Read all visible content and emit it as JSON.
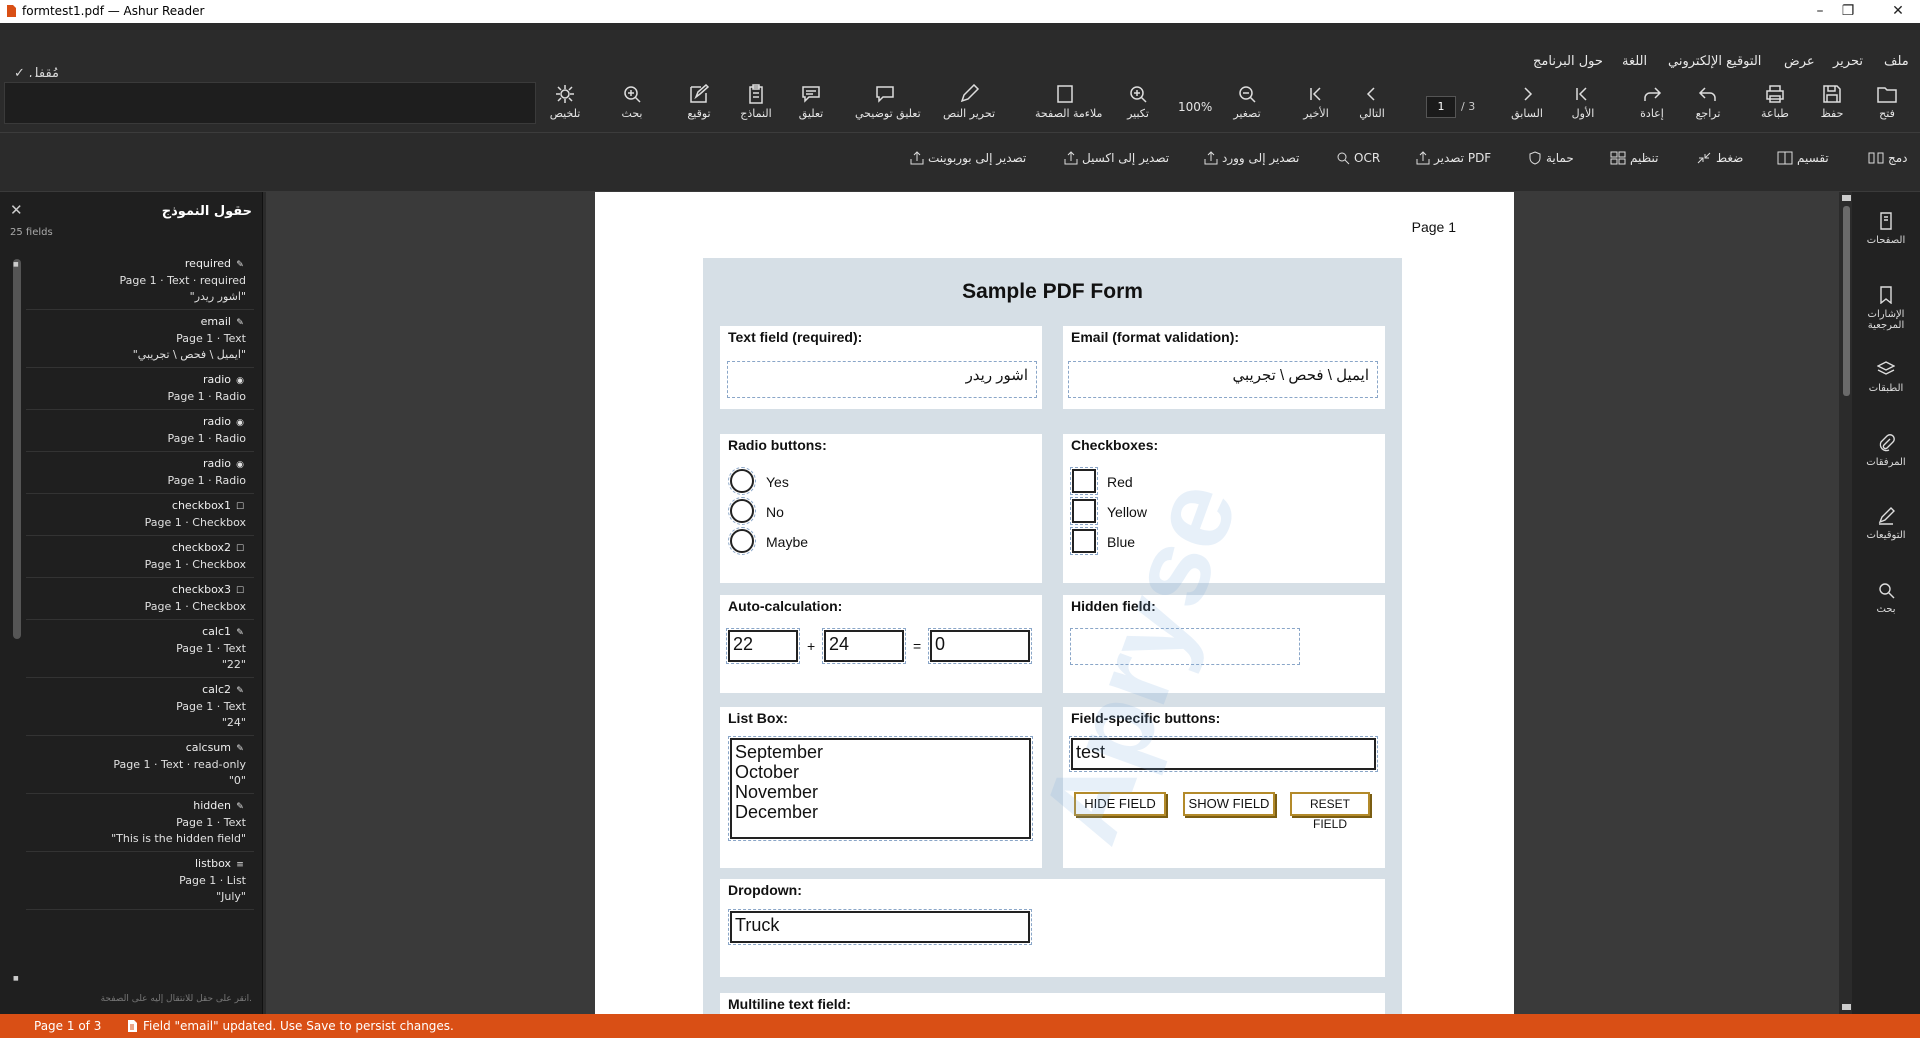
{
  "window": {
    "title": "formtest1.pdf — Ashur Reader"
  },
  "menu": {
    "items": [
      "ملف",
      "تحرير",
      "عرض",
      "التوقيع الإلكتروني",
      "اللغة",
      "حول البرنامج"
    ],
    "locked": "✓ مُقفل"
  },
  "toolbar": {
    "tools": [
      {
        "label": "فتح",
        "icon": "folder-icon"
      },
      {
        "label": "حفظ",
        "icon": "save-icon"
      },
      {
        "label": "طباعة",
        "icon": "print-icon"
      },
      {
        "label": "تراجع",
        "icon": "undo-icon"
      },
      {
        "label": "إعادة",
        "icon": "redo-icon"
      },
      {
        "label": "الأول",
        "icon": "first-page-icon"
      },
      {
        "label": "السابق",
        "icon": "prev-page-icon"
      },
      {
        "label": "التالي",
        "icon": "next-page-icon"
      },
      {
        "label": "الأخير",
        "icon": "last-page-icon"
      },
      {
        "label": "تصغير",
        "icon": "zoom-out-icon"
      },
      {
        "label": "تكبير",
        "icon": "zoom-in-icon"
      },
      {
        "label": "ملاءمة الصفحة",
        "icon": "fit-page-icon"
      },
      {
        "label": "تحرير النص",
        "icon": "edit-text-icon"
      },
      {
        "label": "تعليق توضيحي",
        "icon": "callout-icon"
      },
      {
        "label": "تعليق",
        "icon": "comment-icon"
      },
      {
        "label": "النماذج",
        "icon": "forms-icon"
      },
      {
        "label": "توقيع",
        "icon": "sign-icon"
      },
      {
        "label": "بحث",
        "icon": "search-icon"
      },
      {
        "label": "تلخيص",
        "icon": "summarize-icon"
      }
    ],
    "zoom": "100%",
    "page_current": "1",
    "page_total": "/ 3"
  },
  "toolbar2": {
    "tools": [
      {
        "label": "دمج",
        "icon": "merge-icon"
      },
      {
        "label": "تقسيم",
        "icon": "split-icon"
      },
      {
        "label": "ضغط",
        "icon": "compress-icon"
      },
      {
        "label": "تنظيم",
        "icon": "organize-icon"
      },
      {
        "label": "حماية",
        "icon": "shield-icon"
      },
      {
        "label": "تصدير PDF",
        "icon": "export-icon"
      },
      {
        "label": "OCR",
        "icon": "ocr-icon"
      },
      {
        "label": "تصدير إلى وورد",
        "icon": "export-icon"
      },
      {
        "label": "تصدير إلى اكسيل",
        "icon": "export-icon"
      },
      {
        "label": "تصدير إلى بوربوينت",
        "icon": "export-icon"
      }
    ]
  },
  "panel": {
    "title": "حقول النموذج",
    "count": "25 fields",
    "hint": "انقر على حقل للانتقال إليه على الصفحة.",
    "fields": [
      {
        "name": "required",
        "icon": "✎",
        "meta": "Page 1 · Text · required",
        "value": "\"اشور ريدر\""
      },
      {
        "name": "email",
        "icon": "✎",
        "meta": "Page 1 · Text",
        "value": "\"ايميل \\ فحص \\ تجريبي\""
      },
      {
        "name": "radio",
        "icon": "◉",
        "meta": "Page 1 · Radio",
        "value": ""
      },
      {
        "name": "radio",
        "icon": "◉",
        "meta": "Page 1 · Radio",
        "value": ""
      },
      {
        "name": "radio",
        "icon": "◉",
        "meta": "Page 1 · Radio",
        "value": ""
      },
      {
        "name": "checkbox1",
        "icon": "☐",
        "meta": "Page 1 · Checkbox",
        "value": ""
      },
      {
        "name": "checkbox2",
        "icon": "☐",
        "meta": "Page 1 · Checkbox",
        "value": ""
      },
      {
        "name": "checkbox3",
        "icon": "☐",
        "meta": "Page 1 · Checkbox",
        "value": ""
      },
      {
        "name": "calc1",
        "icon": "✎",
        "meta": "Page 1 · Text",
        "value": "\"22\""
      },
      {
        "name": "calc2",
        "icon": "✎",
        "meta": "Page 1 · Text",
        "value": "\"24\""
      },
      {
        "name": "calcsum",
        "icon": "✎",
        "meta": "Page 1 · Text · read-only",
        "value": "\"0\""
      },
      {
        "name": "hidden",
        "icon": "✎",
        "meta": "Page 1 · Text",
        "value": "\"This is the hidden field\""
      },
      {
        "name": "listbox",
        "icon": "≡",
        "meta": "Page 1 · List",
        "value": "\"July\""
      }
    ]
  },
  "pdf": {
    "page_label": "Page 1",
    "form_title": "Sample PDF Form",
    "text_field": {
      "label": "Text field (required):",
      "value": "اشور ريدر"
    },
    "email_field": {
      "label": "Email (format validation):",
      "value": "ايميل \\ فحص \\ تجريبي"
    },
    "radio": {
      "label": "Radio buttons:",
      "options": [
        "Yes",
        "No",
        "Maybe"
      ]
    },
    "checkboxes": {
      "label": "Checkboxes:",
      "options": [
        "Red",
        "Yellow",
        "Blue"
      ]
    },
    "calc": {
      "label": "Auto-calculation:",
      "a": "22",
      "plus": "+",
      "b": "24",
      "eq": "=",
      "sum": "0"
    },
    "hidden": {
      "label": "Hidden field:"
    },
    "listbox": {
      "label": "List Box:",
      "items": [
        "September",
        "October",
        "November",
        "December"
      ]
    },
    "field_buttons": {
      "label": "Field-specific buttons:",
      "value": "test",
      "hide": "HIDE FIELD",
      "show": "SHOW FIELD",
      "reset": "RESET FIELD"
    },
    "dropdown": {
      "label": "Dropdown:",
      "value": "Truck"
    },
    "multiline": {
      "label": "Multiline text field:"
    },
    "watermark": "Apryse"
  },
  "rail": {
    "items": [
      {
        "label": "الصفحات",
        "icon": "pages-icon"
      },
      {
        "label": "الإشارات المرجعية",
        "icon": "bookmark-icon"
      },
      {
        "label": "الطبقات",
        "icon": "layers-icon"
      },
      {
        "label": "المرفقات",
        "icon": "attachment-icon"
      },
      {
        "label": "التوقيعات",
        "icon": "signature-icon"
      },
      {
        "label": "بحث",
        "icon": "search-icon"
      }
    ]
  },
  "status": {
    "page": "Page 1 of 3",
    "message": "Field \"email\" updated. Use Save to persist changes."
  },
  "colors": {
    "status_bar": "#d94f15",
    "form_bg": "#d6dfe6",
    "button_border": "#b38a2a"
  }
}
